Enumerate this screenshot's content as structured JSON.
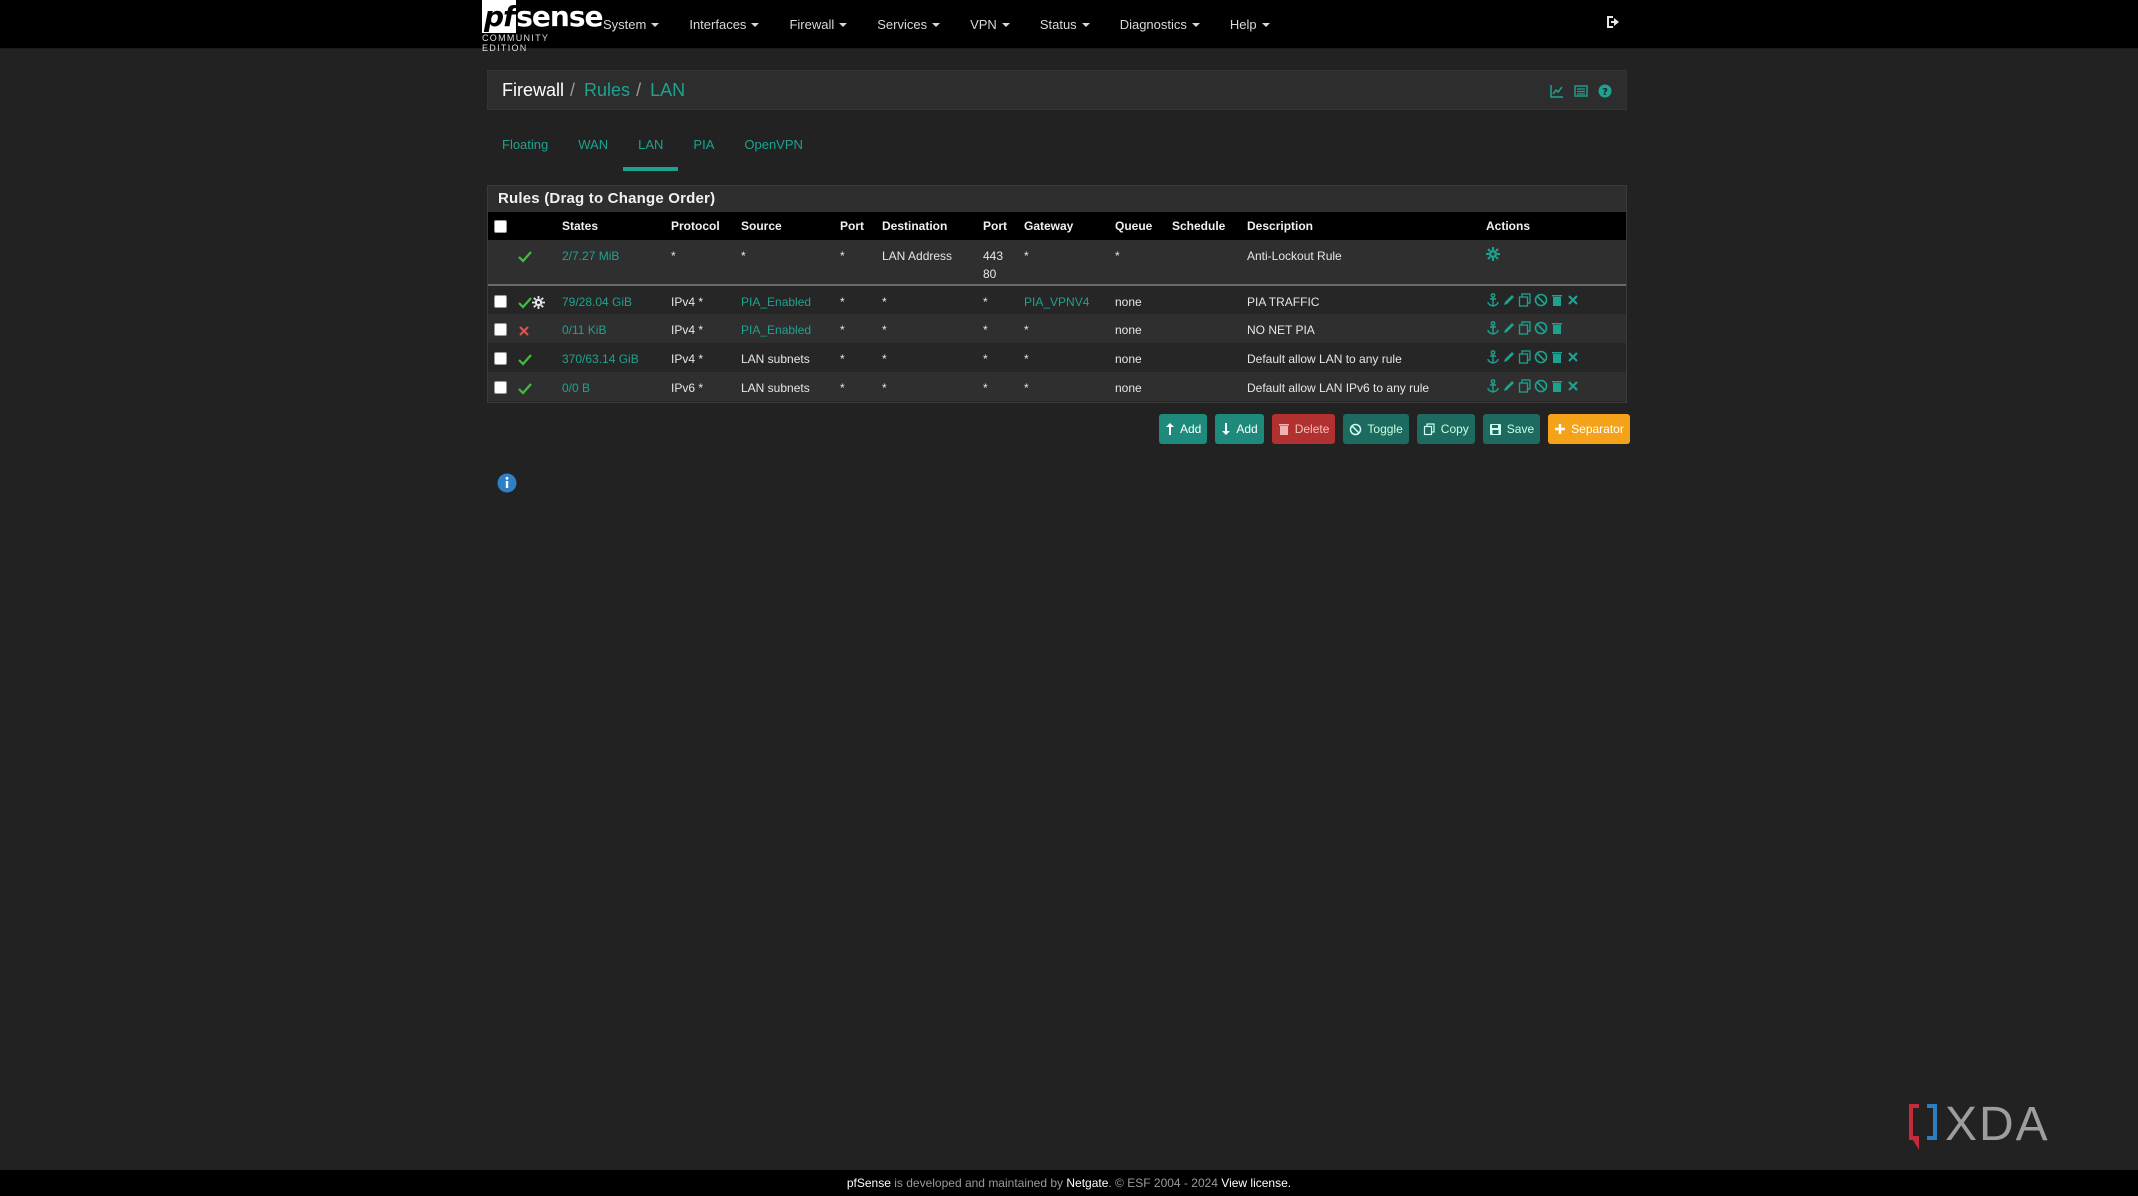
{
  "brand": {
    "name": "pfSense",
    "logo_pf": "pf",
    "logo_rest": "sense",
    "subtitle": "COMMUNITY EDITION"
  },
  "nav": {
    "items": [
      {
        "label": "System"
      },
      {
        "label": "Interfaces"
      },
      {
        "label": "Firewall"
      },
      {
        "label": "Services"
      },
      {
        "label": "VPN"
      },
      {
        "label": "Status"
      },
      {
        "label": "Diagnostics"
      },
      {
        "label": "Help"
      }
    ],
    "logout_icon": "sign-out-icon"
  },
  "breadcrumb": {
    "root": "Firewall",
    "sep": "/",
    "level1": "Rules",
    "level2": "LAN",
    "icons": [
      "chart-icon",
      "list-icon",
      "help-icon"
    ]
  },
  "tabs": [
    {
      "label": "Floating",
      "active": false
    },
    {
      "label": "WAN",
      "active": false
    },
    {
      "label": "LAN",
      "active": true
    },
    {
      "label": "PIA",
      "active": false
    },
    {
      "label": "OpenVPN",
      "active": false
    }
  ],
  "rules": {
    "heading": "Rules (Drag to Change Order)",
    "columns": {
      "states": "States",
      "protocol": "Protocol",
      "source": "Source",
      "port": "Port",
      "destination": "Destination",
      "dport": "Port",
      "gateway": "Gateway",
      "queue": "Queue",
      "schedule": "Schedule",
      "description": "Description",
      "actions": "Actions"
    },
    "rows": [
      {
        "status": "pass",
        "states": "2/7.27 MiB",
        "protocol": "*",
        "source": "*",
        "sport": "*",
        "destination": "LAN Address",
        "dport_l1": "443",
        "dport_l2": "80",
        "gateway": "*",
        "queue": "*",
        "schedule": "",
        "description": "Anti-Lockout Rule"
      },
      {
        "status": "pass",
        "states": "79/28.04 GiB",
        "protocol": "IPv4 *",
        "source": "PIA_Enabled",
        "sport": "*",
        "destination": "*",
        "dport_l1": "*",
        "gateway": "PIA_VPNV4",
        "queue": "none",
        "schedule": "",
        "description": "PIA TRAFFIC"
      },
      {
        "status": "block",
        "states": "0/11 KiB",
        "protocol": "IPv4 *",
        "source": "PIA_Enabled",
        "sport": "*",
        "destination": "*",
        "dport_l1": "*",
        "gateway": "*",
        "queue": "none",
        "schedule": "",
        "description": "NO NET PIA"
      },
      {
        "status": "pass",
        "states": "370/63.14 GiB",
        "protocol": "IPv4 *",
        "source": "LAN subnets",
        "sport": "*",
        "destination": "*",
        "dport_l1": "*",
        "gateway": "*",
        "queue": "none",
        "schedule": "",
        "description": "Default allow LAN to any rule"
      },
      {
        "status": "pass",
        "states": "0/0 B",
        "protocol": "IPv6 *",
        "source": "LAN subnets",
        "sport": "*",
        "destination": "*",
        "dport_l1": "*",
        "gateway": "*",
        "queue": "none",
        "schedule": "",
        "description": "Default allow LAN IPv6 to any rule"
      }
    ]
  },
  "buttons": {
    "add_top": "Add",
    "add_bottom": "Add",
    "delete": "Delete",
    "toggle": "Toggle",
    "copy": "Copy",
    "save": "Save",
    "separator": "Separator"
  },
  "footer": {
    "product": "pfSense",
    "mid": " is developed and maintained by ",
    "company": "Netgate",
    "copy": ". © ESF 2004 - 2024 ",
    "license": "View license."
  },
  "watermark": "XDA",
  "colors": {
    "accent": "#1ea290",
    "pass": "#3fbf3f",
    "block": "#d9534f",
    "orange": "#f5a21b",
    "danger": "#b13030"
  }
}
